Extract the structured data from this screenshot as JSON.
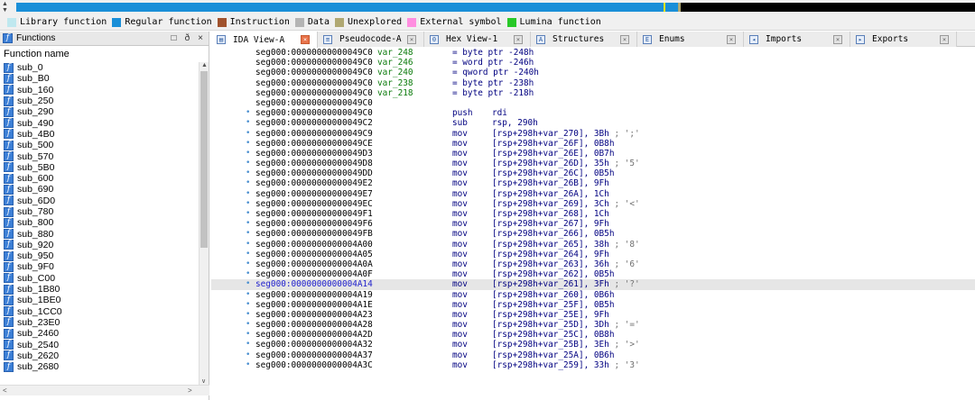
{
  "legend": [
    {
      "label": "Library function",
      "color": "#bfe8ef"
    },
    {
      "label": "Regular function",
      "color": "#1a8fd8"
    },
    {
      "label": "Instruction",
      "color": "#a0522d"
    },
    {
      "label": "Data",
      "color": "#b4b4b4"
    },
    {
      "label": "Unexplored",
      "color": "#b0a872"
    },
    {
      "label": "External symbol",
      "color": "#ff8ee0"
    },
    {
      "label": "Lumina function",
      "color": "#28c828"
    }
  ],
  "functions_panel": {
    "title": "Functions",
    "column_header": "Function name",
    "items": [
      "sub_0",
      "sub_B0",
      "sub_160",
      "sub_250",
      "sub_290",
      "sub_490",
      "sub_4B0",
      "sub_500",
      "sub_570",
      "sub_5B0",
      "sub_600",
      "sub_690",
      "sub_6D0",
      "sub_780",
      "sub_800",
      "sub_880",
      "sub_920",
      "sub_950",
      "sub_9F0",
      "sub_C00",
      "sub_1B80",
      "sub_1BE0",
      "sub_1CC0",
      "sub_23E0",
      "sub_2460",
      "sub_2540",
      "sub_2620",
      "sub_2680"
    ]
  },
  "tabs": [
    {
      "label": "IDA View-A",
      "active": true,
      "icon": "disasm-icon"
    },
    {
      "label": "Pseudocode-A",
      "active": false,
      "icon": "pseudocode-icon"
    },
    {
      "label": "Hex View-1",
      "active": false,
      "icon": "hex-icon"
    },
    {
      "label": "Structures",
      "active": false,
      "icon": "structures-icon"
    },
    {
      "label": "Enums",
      "active": false,
      "icon": "enums-icon"
    },
    {
      "label": "Imports",
      "active": false,
      "icon": "imports-icon"
    },
    {
      "label": "Exports",
      "active": false,
      "icon": "exports-icon"
    }
  ],
  "disasm": [
    {
      "addr": "seg000:00000000000049C0",
      "name": "var_248",
      "def": "= byte ptr -248h"
    },
    {
      "addr": "seg000:00000000000049C0",
      "name": "var_246",
      "def": "= word ptr -246h"
    },
    {
      "addr": "seg000:00000000000049C0",
      "name": "var_240",
      "def": "= qword ptr -240h"
    },
    {
      "addr": "seg000:00000000000049C0",
      "name": "var_238",
      "def": "= byte ptr -238h"
    },
    {
      "addr": "seg000:00000000000049C0",
      "name": "var_218",
      "def": "= byte ptr -218h"
    },
    {
      "addr": "seg000:00000000000049C0"
    },
    {
      "addr": "seg000:00000000000049C0",
      "dot": true,
      "mnem": "push",
      "ops": "rdi"
    },
    {
      "addr": "seg000:00000000000049C2",
      "dot": true,
      "mnem": "sub",
      "ops": "rsp, 290h"
    },
    {
      "addr": "seg000:00000000000049C9",
      "dot": true,
      "mnem": "mov",
      "ops": "[rsp+298h+var_270], 3Bh",
      "cmt": " ; ';'"
    },
    {
      "addr": "seg000:00000000000049CE",
      "dot": true,
      "mnem": "mov",
      "ops": "[rsp+298h+var_26F], 0B8h"
    },
    {
      "addr": "seg000:00000000000049D3",
      "dot": true,
      "mnem": "mov",
      "ops": "[rsp+298h+var_26E], 0B7h"
    },
    {
      "addr": "seg000:00000000000049D8",
      "dot": true,
      "mnem": "mov",
      "ops": "[rsp+298h+var_26D], 35h",
      "cmt": " ; '5'"
    },
    {
      "addr": "seg000:00000000000049DD",
      "dot": true,
      "mnem": "mov",
      "ops": "[rsp+298h+var_26C], 0B5h"
    },
    {
      "addr": "seg000:00000000000049E2",
      "dot": true,
      "mnem": "mov",
      "ops": "[rsp+298h+var_26B], 9Fh"
    },
    {
      "addr": "seg000:00000000000049E7",
      "dot": true,
      "mnem": "mov",
      "ops": "[rsp+298h+var_26A], 1Ch"
    },
    {
      "addr": "seg000:00000000000049EC",
      "dot": true,
      "mnem": "mov",
      "ops": "[rsp+298h+var_269], 3Ch",
      "cmt": " ; '<'"
    },
    {
      "addr": "seg000:00000000000049F1",
      "dot": true,
      "mnem": "mov",
      "ops": "[rsp+298h+var_268], 1Ch"
    },
    {
      "addr": "seg000:00000000000049F6",
      "dot": true,
      "mnem": "mov",
      "ops": "[rsp+298h+var_267], 9Fh"
    },
    {
      "addr": "seg000:00000000000049FB",
      "dot": true,
      "mnem": "mov",
      "ops": "[rsp+298h+var_266], 0B5h"
    },
    {
      "addr": "seg000:0000000000004A00",
      "dot": true,
      "mnem": "mov",
      "ops": "[rsp+298h+var_265], 38h",
      "cmt": " ; '8'"
    },
    {
      "addr": "seg000:0000000000004A05",
      "dot": true,
      "mnem": "mov",
      "ops": "[rsp+298h+var_264], 9Fh"
    },
    {
      "addr": "seg000:0000000000004A0A",
      "dot": true,
      "mnem": "mov",
      "ops": "[rsp+298h+var_263], 36h",
      "cmt": " ; '6'"
    },
    {
      "addr": "seg000:0000000000004A0F",
      "dot": true,
      "mnem": "mov",
      "ops": "[rsp+298h+var_262], 0B5h"
    },
    {
      "addr": "seg000:0000000000004A14",
      "dot": true,
      "mnem": "mov",
      "ops": "[rsp+298h+var_261], 3Fh",
      "cmt": " ; '?'",
      "highlight": true
    },
    {
      "addr": "seg000:0000000000004A19",
      "dot": true,
      "mnem": "mov",
      "ops": "[rsp+298h+var_260], 0B6h"
    },
    {
      "addr": "seg000:0000000000004A1E",
      "dot": true,
      "mnem": "mov",
      "ops": "[rsp+298h+var_25F], 0B5h"
    },
    {
      "addr": "seg000:0000000000004A23",
      "dot": true,
      "mnem": "mov",
      "ops": "[rsp+298h+var_25E], 9Fh"
    },
    {
      "addr": "seg000:0000000000004A28",
      "dot": true,
      "mnem": "mov",
      "ops": "[rsp+298h+var_25D], 3Dh",
      "cmt": " ; '='"
    },
    {
      "addr": "seg000:0000000000004A2D",
      "dot": true,
      "mnem": "mov",
      "ops": "[rsp+298h+var_25C], 0B8h"
    },
    {
      "addr": "seg000:0000000000004A32",
      "dot": true,
      "mnem": "mov",
      "ops": "[rsp+298h+var_25B], 3Eh",
      "cmt": " ; '>'"
    },
    {
      "addr": "seg000:0000000000004A37",
      "dot": true,
      "mnem": "mov",
      "ops": "[rsp+298h+var_25A], 0B6h"
    },
    {
      "addr": "seg000:0000000000004A3C",
      "dot": true,
      "mnem": "mov",
      "ops": "[rsp+298h+var_259], 33h",
      "cmt": " ; '3'"
    }
  ]
}
